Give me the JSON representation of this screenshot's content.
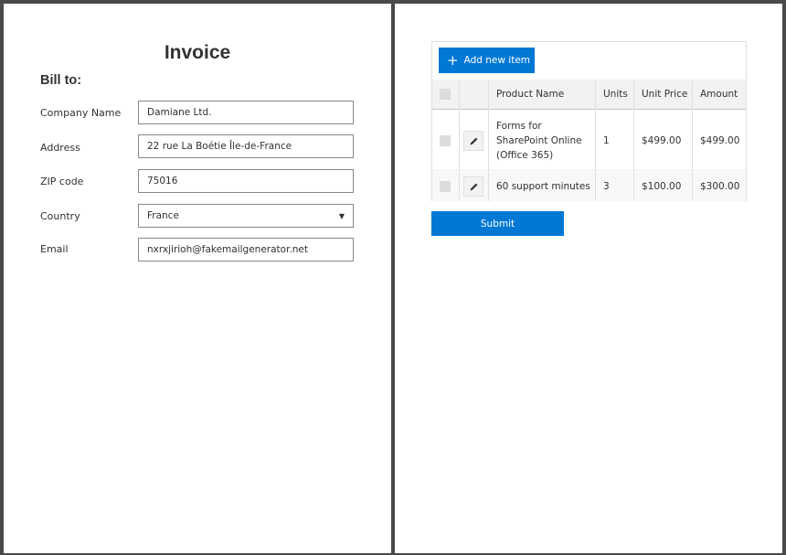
{
  "invoice": {
    "title": "Invoice",
    "bill_to_heading": "Bill to:",
    "fields": {
      "company": {
        "label": "Company Name",
        "value": "Damiane Ltd."
      },
      "address": {
        "label": "Address",
        "value": "22 rue La Boétie Île-de-France"
      },
      "zip": {
        "label": "ZIP code",
        "value": "75016"
      },
      "country": {
        "label": "Country",
        "value": "France"
      },
      "email": {
        "label": "Email",
        "value": "nxrxjirioh@fakemailgenerator.net"
      }
    }
  },
  "items": {
    "add_button_label": "Add new item",
    "columns": {
      "product": "Product Name",
      "units": "Units",
      "unit_price": "Unit Price",
      "amount": "Amount"
    },
    "rows": [
      {
        "product_lines": [
          "Forms for",
          "SharePoint Online",
          "(Office 365)"
        ],
        "units": "1",
        "unit_price": "$499.00",
        "amount": "$499.00"
      },
      {
        "product_lines": [
          "60 support minutes"
        ],
        "units": "3",
        "unit_price": "$100.00",
        "amount": "$300.00"
      }
    ],
    "submit_label": "Submit"
  },
  "icons": {
    "add": "plus-icon",
    "edit": "pencil-icon",
    "dropdown": "chevron-down-icon"
  },
  "colors": {
    "accent": "#0078d4",
    "header_bg": "#f3f2f1",
    "border": "#e1dfdd"
  }
}
